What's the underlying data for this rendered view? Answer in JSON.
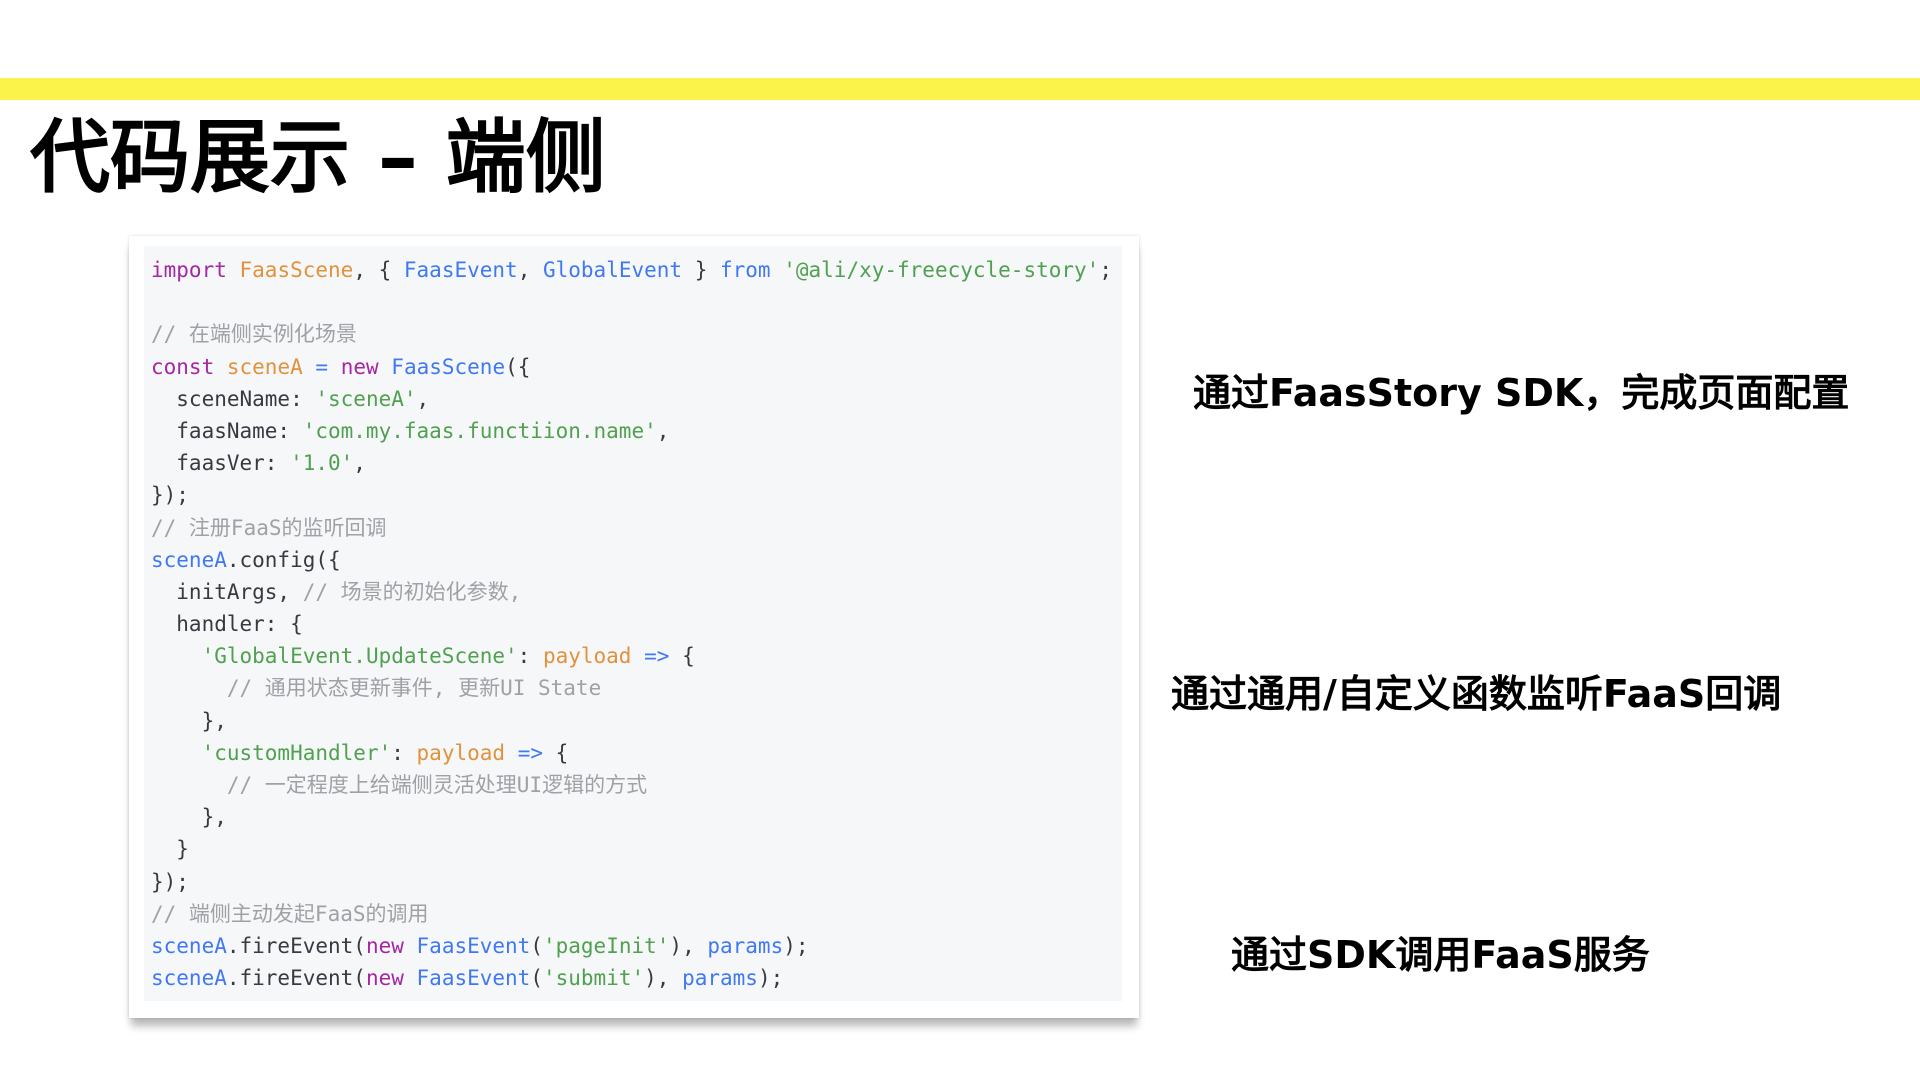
{
  "slide": {
    "title": "代码展示 – 端侧",
    "accent_color": "#fbf34a"
  },
  "code": {
    "background": "#f6f7f9",
    "lines": [
      [
        {
          "t": "import",
          "c": "#a626a4"
        },
        {
          "t": " "
        },
        {
          "t": "FaasScene",
          "c": "#e2913c"
        },
        {
          "t": ", { "
        },
        {
          "t": "FaasEvent",
          "c": "#4078f2"
        },
        {
          "t": ", "
        },
        {
          "t": "GlobalEvent",
          "c": "#4078f2"
        },
        {
          "t": " } "
        },
        {
          "t": "from",
          "c": "#4078f2"
        },
        {
          "t": " "
        },
        {
          "t": "'@ali/xy-freecycle-story'",
          "c": "#50a14f"
        },
        {
          "t": ";"
        }
      ],
      [],
      [
        {
          "t": "// 在端侧实例化场景",
          "c": "#a0a1a7"
        }
      ],
      [
        {
          "t": "const",
          "c": "#a626a4"
        },
        {
          "t": " "
        },
        {
          "t": "sceneA",
          "c": "#e2913c"
        },
        {
          "t": " "
        },
        {
          "t": "=",
          "c": "#4078f2"
        },
        {
          "t": " "
        },
        {
          "t": "new",
          "c": "#a626a4"
        },
        {
          "t": " "
        },
        {
          "t": "FaasScene",
          "c": "#4078f2"
        },
        {
          "t": "({"
        }
      ],
      [
        {
          "t": "  sceneName: "
        },
        {
          "t": "'sceneA'",
          "c": "#50a14f"
        },
        {
          "t": ","
        }
      ],
      [
        {
          "t": "  faasName: "
        },
        {
          "t": "'com.my.faas.functiion.name'",
          "c": "#50a14f"
        },
        {
          "t": ","
        }
      ],
      [
        {
          "t": "  faasVer: "
        },
        {
          "t": "'1.0'",
          "c": "#50a14f"
        },
        {
          "t": ","
        }
      ],
      [
        {
          "t": "});"
        }
      ],
      [
        {
          "t": "// 注册FaaS的监听回调",
          "c": "#a0a1a7"
        }
      ],
      [
        {
          "t": "sceneA",
          "c": "#4078f2"
        },
        {
          "t": ".config({"
        }
      ],
      [
        {
          "t": "  initArgs, "
        },
        {
          "t": "// 场景的初始化参数,",
          "c": "#a0a1a7"
        }
      ],
      [
        {
          "t": "  handler: {"
        }
      ],
      [
        {
          "t": "    "
        },
        {
          "t": "'GlobalEvent.UpdateScene'",
          "c": "#50a14f"
        },
        {
          "t": ": "
        },
        {
          "t": "payload",
          "c": "#e2913c"
        },
        {
          "t": " "
        },
        {
          "t": "=>",
          "c": "#4078f2"
        },
        {
          "t": " {"
        }
      ],
      [
        {
          "t": "      "
        },
        {
          "t": "// 通用状态更新事件, 更新UI State",
          "c": "#a0a1a7"
        }
      ],
      [
        {
          "t": "    },"
        }
      ],
      [
        {
          "t": "    "
        },
        {
          "t": "'customHandler'",
          "c": "#50a14f"
        },
        {
          "t": ": "
        },
        {
          "t": "payload",
          "c": "#e2913c"
        },
        {
          "t": " "
        },
        {
          "t": "=>",
          "c": "#4078f2"
        },
        {
          "t": " {"
        }
      ],
      [
        {
          "t": "      "
        },
        {
          "t": "// 一定程度上给端侧灵活处理UI逻辑的方式",
          "c": "#a0a1a7"
        }
      ],
      [
        {
          "t": "    },"
        }
      ],
      [
        {
          "t": "  }"
        }
      ],
      [
        {
          "t": "});"
        }
      ],
      [
        {
          "t": "// 端侧主动发起FaaS的调用",
          "c": "#a0a1a7"
        }
      ],
      [
        {
          "t": "sceneA",
          "c": "#4078f2"
        },
        {
          "t": ".fireEvent("
        },
        {
          "t": "new",
          "c": "#a626a4"
        },
        {
          "t": " "
        },
        {
          "t": "FaasEvent",
          "c": "#4078f2"
        },
        {
          "t": "("
        },
        {
          "t": "'pageInit'",
          "c": "#50a14f"
        },
        {
          "t": "), "
        },
        {
          "t": "params",
          "c": "#4078f2"
        },
        {
          "t": ");"
        }
      ],
      [
        {
          "t": "sceneA",
          "c": "#4078f2"
        },
        {
          "t": ".fireEvent("
        },
        {
          "t": "new",
          "c": "#a626a4"
        },
        {
          "t": " "
        },
        {
          "t": "FaasEvent",
          "c": "#4078f2"
        },
        {
          "t": "("
        },
        {
          "t": "'submit'",
          "c": "#50a14f"
        },
        {
          "t": "), "
        },
        {
          "t": "params",
          "c": "#4078f2"
        },
        {
          "t": ");"
        }
      ]
    ]
  },
  "captions": [
    "通过FaasStory SDK，完成页面配置",
    "通过通用/自定义函数监听FaaS回调",
    "通过SDK调用FaaS服务"
  ]
}
